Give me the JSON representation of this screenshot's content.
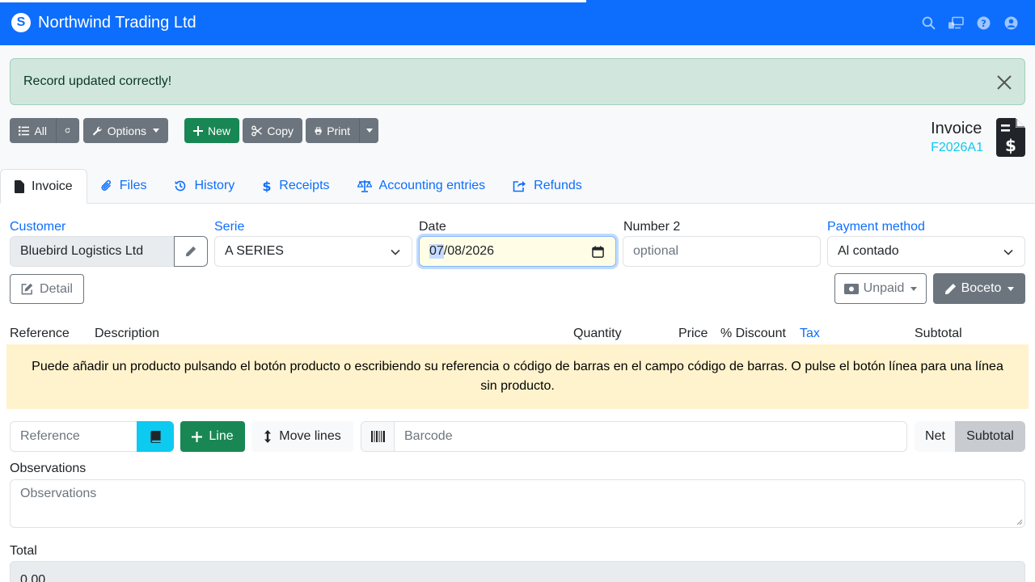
{
  "app": {
    "title": "Northwind Trading Ltd",
    "logo_glyph": "S",
    "icons": [
      "search-icon",
      "screen-icon",
      "help-icon",
      "user-icon"
    ]
  },
  "alert": {
    "message": "Record updated correctly!"
  },
  "toolbar": {
    "all_label": "All",
    "options_label": "Options",
    "new_label": "New",
    "copy_label": "Copy",
    "print_label": "Print"
  },
  "document": {
    "type": "Invoice",
    "code": "F2026A1"
  },
  "tabs": [
    {
      "label": "Invoice",
      "icon": "file-icon"
    },
    {
      "label": "Files",
      "icon": "paperclip-icon"
    },
    {
      "label": "History",
      "icon": "history-icon"
    },
    {
      "label": "Receipts",
      "icon": "dollar-icon"
    },
    {
      "label": "Accounting entries",
      "icon": "balance-scale-icon"
    },
    {
      "label": "Refunds",
      "icon": "share-icon"
    }
  ],
  "form": {
    "customer_label": "Customer",
    "customer_value": "Bluebird Logistics Ltd",
    "serie_label": "Serie",
    "serie_value": "A SERIES",
    "date_label": "Date",
    "date_day": "07",
    "date_rest": "/08/2026",
    "number2_label": "Number 2",
    "number2_placeholder": "optional",
    "payment_label": "Payment method",
    "payment_value": "Al contado",
    "detail_label": "Detail",
    "unpaid_label": "Unpaid",
    "boceto_label": "Boceto"
  },
  "lines_table": {
    "headers": {
      "reference": "Reference",
      "description": "Description",
      "quantity": "Quantity",
      "price": "Price",
      "discount": "% Discount",
      "tax": "Tax",
      "subtotal": "Subtotal"
    },
    "empty_message": "Puede añadir un producto pulsando el botón producto o escribiendo su referencia o código de barras en el campo código de barras. O pulse el botón línea para una línea sin producto."
  },
  "add_line": {
    "reference_placeholder": "Reference",
    "line_label": "Line",
    "move_lines_label": "Move lines",
    "barcode_placeholder": "Barcode",
    "net_label": "Net",
    "subtotal_label": "Subtotal"
  },
  "observations": {
    "label": "Observations",
    "placeholder": "Observations"
  },
  "total": {
    "label": "Total",
    "value": "0,00"
  },
  "colors": {
    "primary": "#0d6efd",
    "success": "#198754",
    "secondary": "#6c757d",
    "info": "#0dcaf0",
    "alert_bg": "#d1e7dd",
    "warning_bg": "#fff3cd"
  }
}
